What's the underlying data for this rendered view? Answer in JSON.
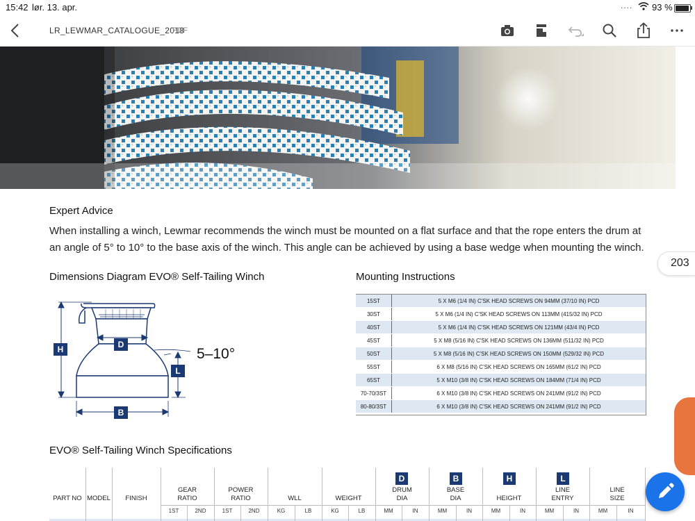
{
  "status": {
    "time": "15:42",
    "date": "lør. 13. apr.",
    "dots": "....",
    "battery": "93 %"
  },
  "nav": {
    "title": "LR_LEWMAR_CATALOGUE_2018",
    "file_type": "PDF"
  },
  "expert": {
    "heading": "Expert Advice",
    "body": "When installing a winch, Lewmar recommends the winch must be mounted on a flat surface and that the rope enters the drum at an angle of 5° to 10° to the base axis of the winch. This angle can be achieved by using a base wedge when mounting the winch."
  },
  "page_number": "203",
  "diagram": {
    "heading": "Dimensions Diagram EVO® Self-Tailing Winch",
    "angle_label": "5–10°",
    "labels": {
      "drum": "D",
      "height": "H",
      "line_entry": "L",
      "base": "B"
    }
  },
  "mounting": {
    "heading": "Mounting Instructions",
    "rows": [
      {
        "model": "15ST",
        "desc": "5 X M6 (1/4 IN) C'SK HEAD SCREWS ON 94MM (37/10 IN) PCD"
      },
      {
        "model": "30ST",
        "desc": "5 X M6 (1/4 IN) C'SK HEAD SCREWS ON 113MM (415/32 IN) PCD"
      },
      {
        "model": "40ST",
        "desc": "5 X M6 (1/4 IN) C'SK HEAD SCREWS ON 121MM (43/4 IN) PCD"
      },
      {
        "model": "45ST",
        "desc": "5 X M8 (5/16 IN) C'SK HEAD SCREWS ON 136MM (511/32 IN) PCD"
      },
      {
        "model": "50ST",
        "desc": "5 X M8 (5/16 IN) C'SK HEAD SCREWS ON 150MM (529/32 IN) PCD"
      },
      {
        "model": "55ST",
        "desc": "6 X M8 (5/16 IN) C'SK HEAD SCREWS ON 165MM (61/2 IN) PCD"
      },
      {
        "model": "65ST",
        "desc": "5 X M10 (3/8 IN) C'SK HEAD SCREWS ON 184MM (71/4 IN) PCD"
      },
      {
        "model": "70-70/3ST",
        "desc": "6 X M10 (3/8 IN) C'SK HEAD SCREWS ON 241MM (91/2 IN) PCD"
      },
      {
        "model": "80-80/3ST",
        "desc": "6 X M10 (3/8 IN) C'SK HEAD SCREWS ON 241MM (91/2 IN) PCD"
      }
    ]
  },
  "spec": {
    "heading": "EVO® Self-Tailing Winch Specifications",
    "columns": {
      "part_no": "PART NO",
      "model": "MODEL",
      "finish": "FINISH",
      "gear_ratio": "GEAR\nRATIO",
      "power_ratio": "POWER\nRATIO",
      "wll": "WLL",
      "weight": "WEIGHT",
      "drum_dia": "DRUM\nDIA",
      "base_dia": "BASE\nDIA",
      "height": "HEIGHT",
      "line_entry": "LINE\nENTRY",
      "line_size": "LINE\nSIZE"
    },
    "subs": {
      "gear_1": "1ST",
      "gear_2": "2ND",
      "power_1": "1ST",
      "power_2": "2ND",
      "wll_kg": "KG",
      "wll_lb": "LB",
      "weight_kg": "KG",
      "weight_lb": "LB",
      "drum_mm": "MM",
      "drum_in": "IN",
      "base_mm": "MM",
      "base_in": "IN",
      "height_mm": "MM",
      "height_in": "IN",
      "entry_mm": "MM",
      "entry_in": "IN",
      "size_mm": "MM",
      "size_in": "IN"
    },
    "badges": {
      "drum": "D",
      "base": "B",
      "height": "H",
      "line_entry": "L"
    }
  },
  "colors": {
    "navy": "#1b3a73",
    "row_tint": "#dde8f3",
    "fab": "#1a73e8",
    "orange_tab": "#e8743e"
  },
  "icons": [
    "back-chevron-icon",
    "camera-icon",
    "bookmark-icon",
    "undo-icon",
    "search-icon",
    "share-icon",
    "more-icon",
    "pencil-icon",
    "wifi-icon",
    "battery-icon"
  ]
}
